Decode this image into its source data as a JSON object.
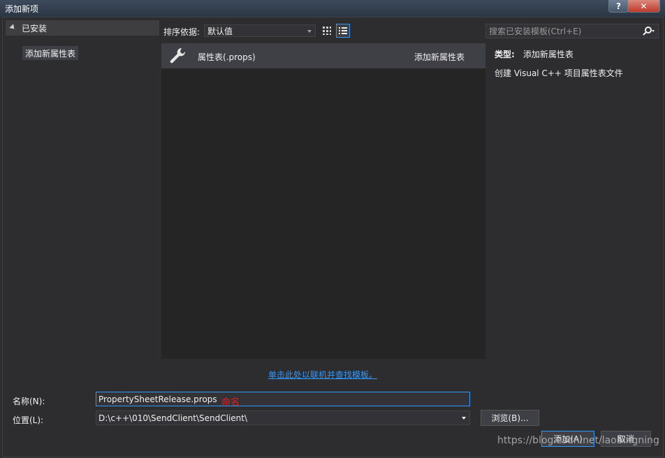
{
  "window": {
    "title": "添加新项",
    "help_label": "?",
    "close_label": "✕"
  },
  "sidebar": {
    "header": "已安装",
    "items": [
      {
        "label": "添加新属性表"
      }
    ]
  },
  "toolbar": {
    "sort_label": "排序依据:",
    "sort_value": "默认值",
    "search_placeholder": "搜索已安装模板(Ctrl+E)"
  },
  "templates": [
    {
      "icon": "wrench-icon",
      "name": "属性表(.props)",
      "type": "添加新属性表"
    }
  ],
  "details": {
    "type_label": "类型:",
    "type_value": "添加新属性表",
    "description": "创建 Visual C++ 项目属性表文件"
  },
  "online_link": "单击此处以联机并查找模板。",
  "form": {
    "name_label": "名称(N):",
    "name_value": "PropertySheetRelease.props",
    "name_annotation": "命名",
    "location_label": "位置(L):",
    "location_value": "D:\\c++\\010\\SendClient\\SendClient\\",
    "browse_label": "浏览(B)...",
    "add_label": "添加(A)",
    "cancel_label": "取消"
  },
  "watermark": "https://blog.csdn.net/laobingning",
  "colors": {
    "accent": "#3399ff",
    "background": "#2d2d30",
    "list_bg": "#252526",
    "selected_bg": "#3f3f46",
    "annotation": "#e02020"
  }
}
